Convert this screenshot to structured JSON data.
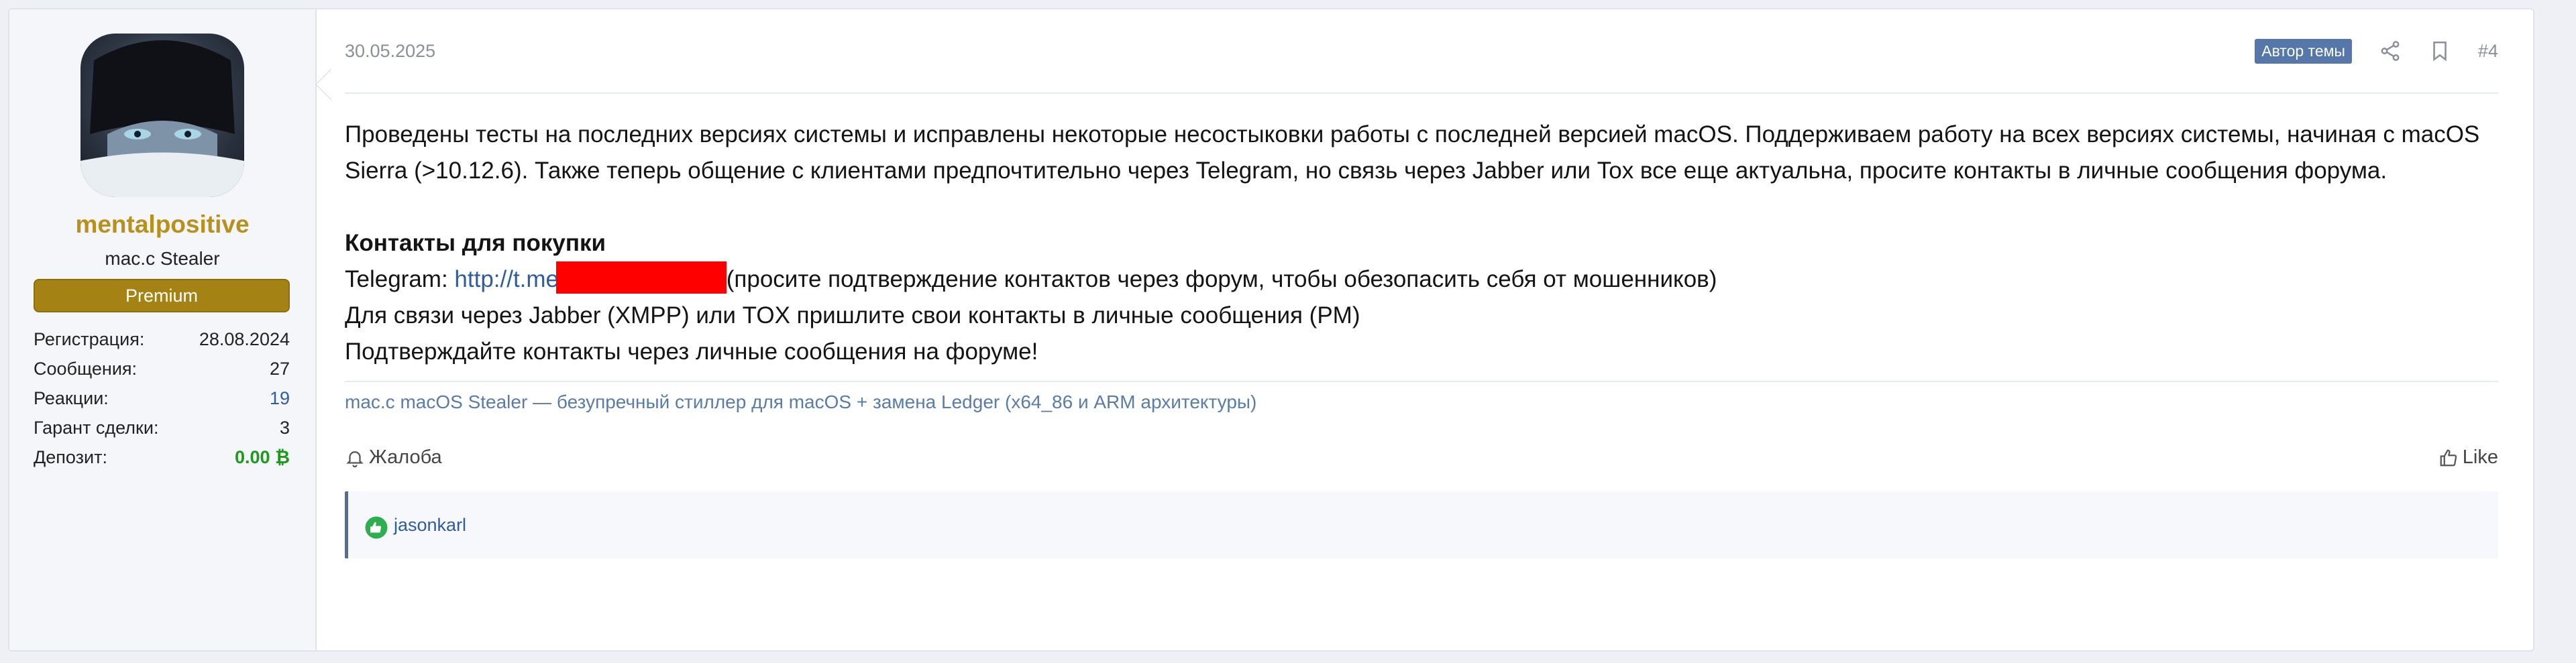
{
  "user": {
    "username": "mentalpositive",
    "title": "mac.c Stealer",
    "banner": "Premium",
    "stats": [
      {
        "label": "Регистрация:",
        "value": "28.08.2024"
      },
      {
        "label": "Сообщения:",
        "value": "27"
      },
      {
        "label": "Реакции:",
        "value": "19"
      },
      {
        "label": "Гарант сделки:",
        "value": "3"
      },
      {
        "label": "Депозит:",
        "value": "0.00 ₿"
      }
    ]
  },
  "post": {
    "date": "30.05.2025",
    "author_badge": "Автор темы",
    "number": "#4",
    "body": {
      "paragraph1": "Проведены тесты на последних версиях системы и исправлены некоторые несостыковки работы с последней версией macOS. Поддерживаем работу на всех версиях системы, начиная с macOS Sierra (>10.12.6). Также теперь общение с клиентами предпочтительно через Telegram, но связь через Jabber или Tox все еще актуальна, просите контакты в личные сообщения форума.",
      "contacts_title": "Контакты для покупки",
      "telegram_label": "Telegram: ",
      "telegram_link": "http://t.me/",
      "telegram_note": "(просите подтверждение контактов через форум, чтобы обезопасить себя от мошенников)",
      "line_jabber": "Для связи через Jabber (XMPP) или TOX пришлите свои контакты в личные сообщения (PM)",
      "line_confirm": "Подтверждайте контакты через личные сообщения на форуме!"
    },
    "signature": "mac.c macOS Stealer — безупречный стиллер для macOS + замена Ledger (x64_86 и ARM архитектуры)",
    "report_label": "Жалоба",
    "like_label": "Like",
    "likes_user": "jasonkarl"
  },
  "colors": {
    "username": "#b8901c",
    "banner": "#a48213",
    "link": "#2f5c9e",
    "deposit": "#1b9a1b",
    "badge": "#5577aa",
    "redaction": "#ff0000"
  }
}
